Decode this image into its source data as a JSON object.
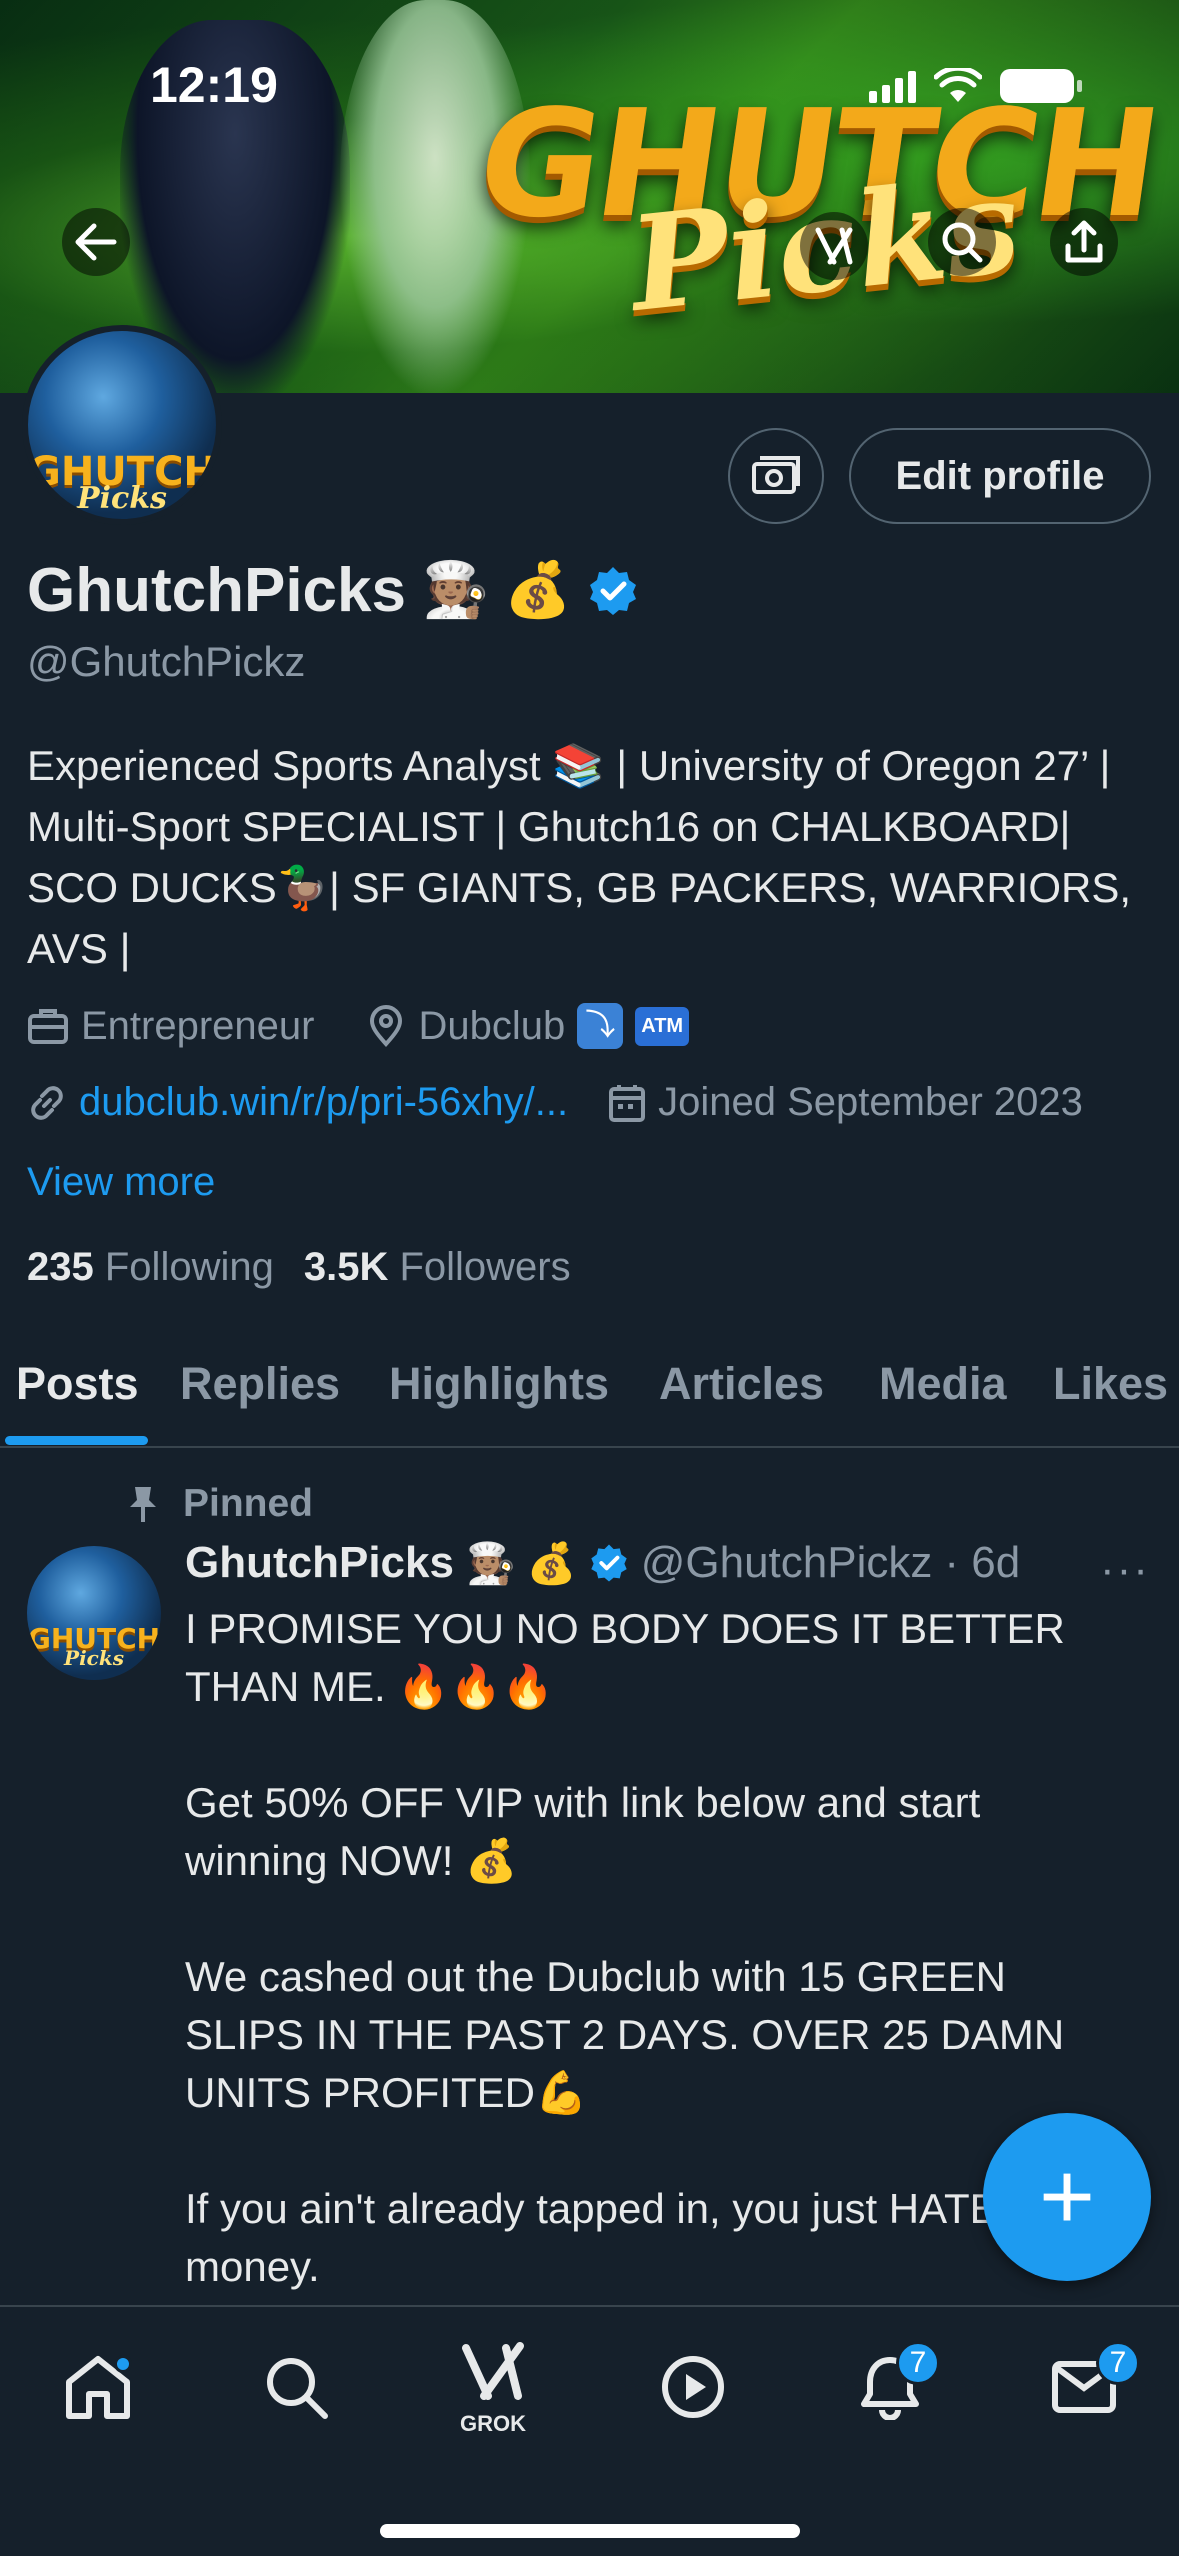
{
  "status_bar": {
    "time": "12:19"
  },
  "banner": {
    "logo_main": "GHUTCH",
    "logo_sub": "Picks"
  },
  "avatar": {
    "logo_main": "GHUTCH",
    "logo_sub": "Picks"
  },
  "actions": {
    "edit_profile": "Edit profile"
  },
  "profile": {
    "display_name": "GhutchPicks",
    "name_emojis": "🧑🏽‍🍳 💰",
    "handle": "@GhutchPickz",
    "bio": "Experienced Sports Analyst 📚 | University of Oregon 27’ | Multi-Sport SPECIALIST | Ghutch16 on CHALKBOARD| SCO DUCKS🦆| SF GIANTS, GB PACKERS, WARRIORS, AVS |",
    "occupation": "Entrepreneur",
    "location": "Dubclub",
    "location_badge": "ATM",
    "location_arrow": "⤵",
    "link": "dubclub.win/r/p/pri-56xhy/...",
    "joined": "Joined September 2023",
    "view_more": "View more",
    "following_count": "235",
    "following_label": "Following",
    "followers_count": "3.5K",
    "followers_label": "Followers"
  },
  "tabs": [
    {
      "label": "Posts",
      "active": true
    },
    {
      "label": "Replies"
    },
    {
      "label": "Highlights"
    },
    {
      "label": "Articles"
    },
    {
      "label": "Media"
    },
    {
      "label": "Likes"
    }
  ],
  "post": {
    "pinned_label": "Pinned",
    "author_name": "GhutchPicks",
    "author_emojis": "🧑🏽‍🍳 💰",
    "author_handle": "@GhutchPickz",
    "time": "· 6d",
    "more": "···",
    "paragraphs": [
      "I PROMISE YOU NO BODY DOES IT BETTER THAN ME. 🔥🔥🔥",
      "Get 50% OFF VIP with link below and start winning NOW! 💰",
      "We cashed out the Dubclub with 15 GREEN SLIPS IN THE PAST 2 DAYS. OVER 25 DAMN UNITS PROFITED💪",
      "If you ain't already tapped in, you just HATE money."
    ]
  },
  "fab": {
    "icon": "+"
  },
  "bottom_nav": {
    "grok_label": "GROK",
    "notifications_badge": "7",
    "messages_badge": "7"
  },
  "colors": {
    "accent": "#1d9bf0",
    "background": "#15202b",
    "muted": "#8b98a5",
    "text": "#e7e9ea"
  }
}
